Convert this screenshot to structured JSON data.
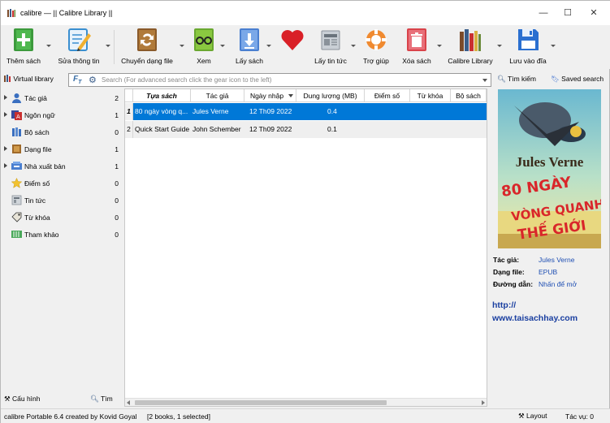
{
  "window": {
    "title": "calibre — || Calibre Library ||",
    "controls": [
      "—",
      "☐",
      "✕"
    ]
  },
  "toolbar": {
    "buttons": [
      {
        "label": "Thêm sách",
        "icon": "add-book-icon",
        "color": "#3c9a3c"
      },
      {
        "label": "Sửa thông tin",
        "icon": "edit-metadata-icon",
        "color": "#3a8fd0"
      },
      {
        "label": "Chuyển dạng file",
        "icon": "convert-icon",
        "color": "#a06a2a"
      },
      {
        "label": "Xem",
        "icon": "view-icon",
        "color": "#6aa830"
      },
      {
        "label": "Lấy sách",
        "icon": "get-books-icon",
        "color": "#4a7fd0"
      },
      {
        "label": "",
        "icon": "donate-heart-icon",
        "color": "#d92027"
      },
      {
        "label": "Lấy tin tức",
        "icon": "news-icon",
        "color": "#9aa2aa"
      },
      {
        "label": "Trợ giúp",
        "icon": "help-icon",
        "color": "#f08a30"
      },
      {
        "label": "Xóa sách",
        "icon": "remove-icon",
        "color": "#d9434a"
      },
      {
        "label": "Calibre Library",
        "icon": "library-icon",
        "color": "#7a4a2a"
      },
      {
        "label": "Lưu vào đĩa",
        "icon": "save-icon",
        "color": "#2a6fd0"
      }
    ]
  },
  "search": {
    "virtual_library": "Virtual library",
    "placeholder": "Search (For advanced search click the gear icon to the left)",
    "search_button": "Tìm kiếm",
    "saved_search": "Saved search"
  },
  "tag_browser": {
    "items": [
      {
        "label": "Tác giả",
        "count": "2",
        "expandable": true,
        "icon": "author-icon"
      },
      {
        "label": "Ngôn ngữ",
        "count": "1",
        "expandable": true,
        "icon": "language-icon"
      },
      {
        "label": "Bộ sách",
        "count": "0",
        "expandable": false,
        "icon": "series-icon"
      },
      {
        "label": "Dạng file",
        "count": "1",
        "expandable": true,
        "icon": "format-icon"
      },
      {
        "label": "Nhà xuất bản",
        "count": "1",
        "expandable": true,
        "icon": "publisher-icon"
      },
      {
        "label": "Điểm số",
        "count": "0",
        "expandable": false,
        "icon": "rating-icon"
      },
      {
        "label": "Tin tức",
        "count": "0",
        "expandable": false,
        "icon": "news-icon"
      },
      {
        "label": "Từ khóa",
        "count": "0",
        "expandable": false,
        "icon": "tag-icon"
      },
      {
        "label": "Tham khảo",
        "count": "0",
        "expandable": false,
        "icon": "identifier-icon"
      }
    ],
    "configure": "Cấu hình",
    "find": "Tìm"
  },
  "book_list": {
    "columns": [
      "Tựa sách",
      "Tác giả",
      "Ngày nhập",
      "Dung lượng (MB)",
      "Điểm số",
      "Từ khóa",
      "Bộ sách"
    ],
    "rows": [
      {
        "num": "1",
        "title": "80 ngày vòng q...",
        "author": "Jules Verne",
        "date": "12 Th09 2022",
        "size": "0.4",
        "selected": true
      },
      {
        "num": "2",
        "title": "Quick Start Guide",
        "author": "John Schember",
        "date": "12 Th09 2022",
        "size": "0.1",
        "selected": false
      }
    ]
  },
  "details": {
    "cover": {
      "author": "Jules Verne",
      "line1": "80 NGÀY",
      "line2": "VÒNG QUANH",
      "line3": "THẾ GIỚI"
    },
    "author_label": "Tác giả:",
    "author_value": "Jules Verne",
    "format_label": "Dạng file:",
    "format_value": "EPUB",
    "path_label": "Đường dẫn:",
    "path_value": "Nhấn để mở",
    "link_line1": "http://",
    "link_line2": "www.taisachhay.com"
  },
  "status": {
    "left": "calibre Portable 6.4 created by Kovid Goyal",
    "books": "[2 books, 1 selected]",
    "layout": "Layout",
    "jobs": "Tác vụ: 0"
  }
}
